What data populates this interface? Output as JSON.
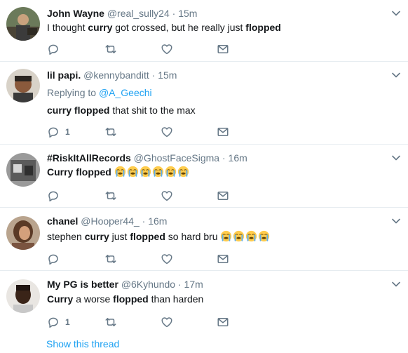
{
  "tweets": [
    {
      "name": "John Wayne",
      "handle": "@real_sully24",
      "time": "15m",
      "text_parts": [
        "I thought ",
        "curry",
        " got crossed, but he really just ",
        "flopped"
      ],
      "reply_count": ""
    },
    {
      "name": "lil papi.",
      "handle": "@kennybanditt",
      "time": "15m",
      "replying_label": "Replying to",
      "replying_to": "@A_Geechi",
      "text_parts": [
        "curry",
        " ",
        "flopped",
        " that shit to the max"
      ],
      "reply_count": "1"
    },
    {
      "name": "#RiskItAllRecords",
      "handle": "@GhostFaceSigma",
      "time": "16m",
      "text_parts": [
        "Curry",
        " ",
        "flopped"
      ],
      "emoji_count": 6,
      "reply_count": ""
    },
    {
      "name": "chanel",
      "handle": "@Hooper44_",
      "time": "16m",
      "text_parts": [
        "stephen ",
        "curry",
        " just ",
        "flopped",
        " so hard bru"
      ],
      "emoji_count": 4,
      "reply_count": ""
    },
    {
      "name": "My PG is better",
      "handle": "@6Kyhundo",
      "time": "17m",
      "text_parts": [
        "Curry",
        " a worse ",
        "flopped",
        " than harden"
      ],
      "reply_count": "1"
    }
  ],
  "separator": "·",
  "show_thread": "Show this thread",
  "icons": {
    "reply": "reply-icon",
    "retweet": "retweet-icon",
    "like": "heart-icon",
    "dm": "envelope-icon",
    "caret": "chevron-down-icon",
    "emoji": "loudly-crying-face-emoji"
  },
  "colors": {
    "text": "#14171a",
    "muted": "#657786",
    "link": "#1da1f2",
    "border": "#e6ecf0",
    "emoji": "#ffcc4d"
  }
}
